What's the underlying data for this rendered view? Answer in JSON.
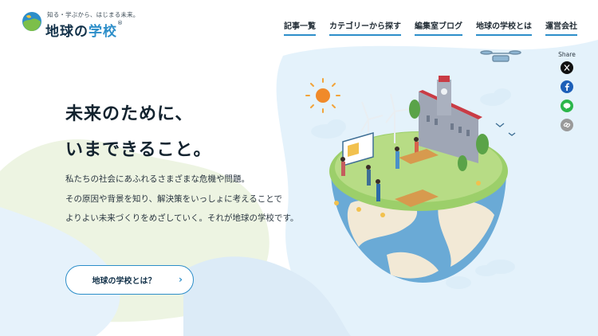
{
  "header": {
    "tagline": "知る・学ぶから、はじまる未来。",
    "logo_text_a": "地球の",
    "logo_text_b": "学校",
    "logo_registered": "®",
    "nav": [
      {
        "label": "記事一覧"
      },
      {
        "label": "カテゴリーから探す"
      },
      {
        "label": "編集室ブログ"
      },
      {
        "label": "地球の学校とは"
      },
      {
        "label": "運営会社"
      }
    ]
  },
  "hero": {
    "title_lines": [
      "未来のために、",
      "いまできること。"
    ],
    "body_lines": [
      "私たちの社会にあふれるさまざまな危機や問題。",
      "その原因や背景を知り、解決策をいっしょに考えることで",
      "よりよい未来づくりをめざしていく。それが地球の学校です。"
    ],
    "cta_label": "地球の学校とは？",
    "cta_arrow": "›"
  },
  "share": {
    "label": "Share",
    "buttons": [
      {
        "icon": "x-icon",
        "color": "#111111"
      },
      {
        "icon": "facebook-icon",
        "color": "#1d5fb8"
      },
      {
        "icon": "line-icon",
        "color": "#2bb64a"
      },
      {
        "icon": "link-icon",
        "color": "#9a9a9a"
      }
    ]
  },
  "colors": {
    "accent": "#2c8ec9",
    "bg_light_blue": "#e4f2fb",
    "bg_light_green": "#eaf3de"
  }
}
